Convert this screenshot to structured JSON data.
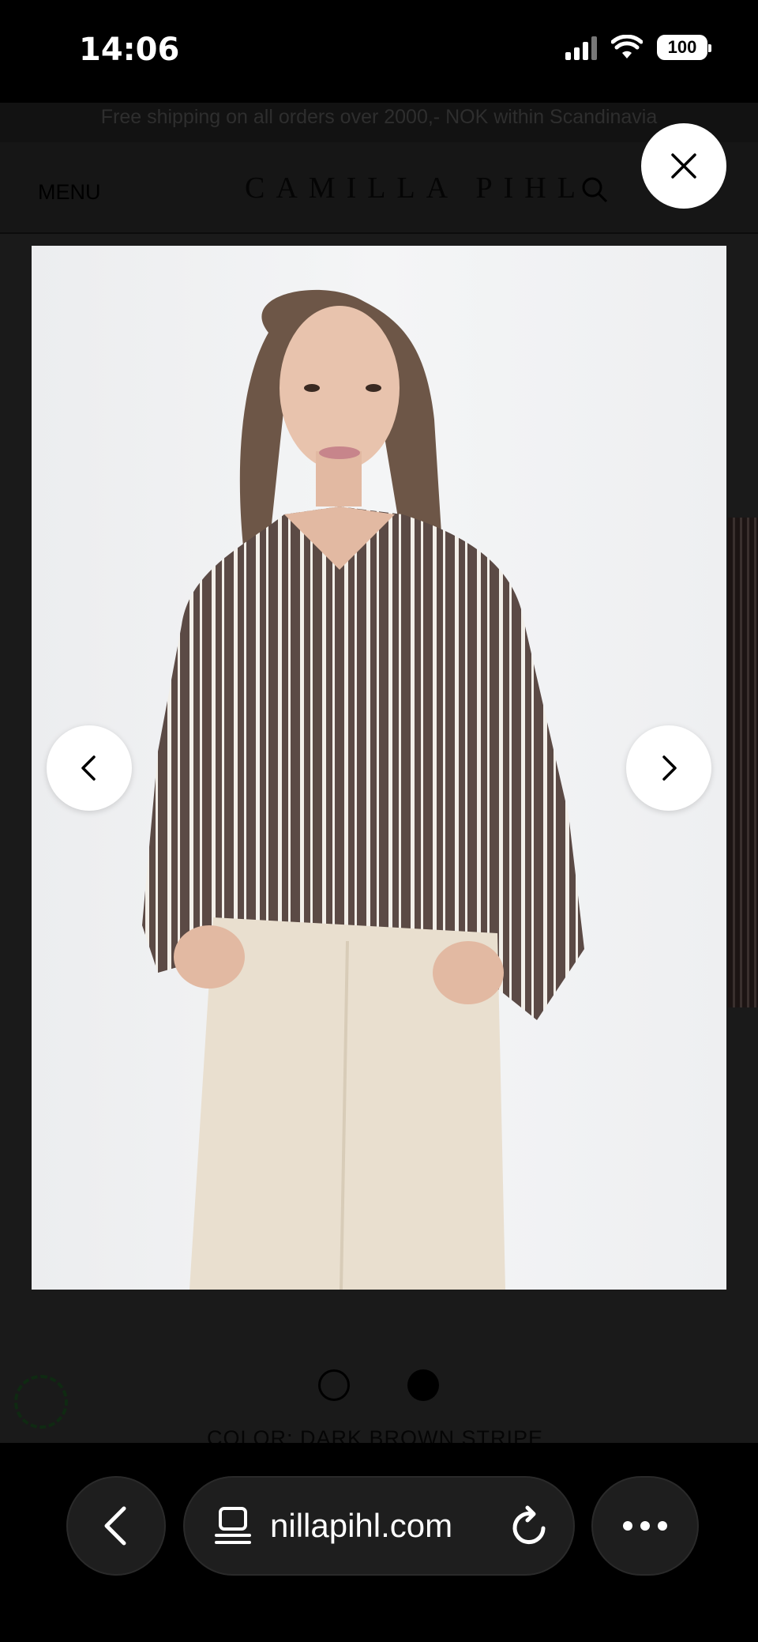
{
  "status_bar": {
    "time": "14:06",
    "battery": "100"
  },
  "site": {
    "promo_text": "Free shipping on all orders over 2000,- NOK within Scandinavia",
    "menu_label": "MENU",
    "brand": "CAMILLA PIHL",
    "color_label": "COLOR: DARK BROWN STRIPE"
  },
  "gallery": {
    "image_colors": {
      "background": "#eeeff1",
      "shirt": "#5b4a45",
      "stripe": "#f2efe9",
      "pants": "#e9dfcf"
    }
  },
  "browser": {
    "url": "nillapihl.com"
  },
  "icons": [
    "close-icon",
    "chevron-left-icon",
    "chevron-right-icon",
    "search-icon",
    "tab-icon",
    "reload-icon",
    "more-icon",
    "back-icon"
  ]
}
